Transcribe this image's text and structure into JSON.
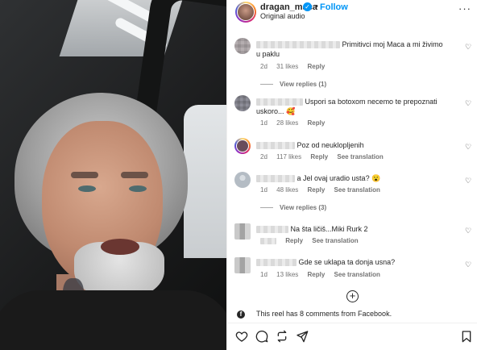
{
  "header": {
    "username": "dragan_maca",
    "verified_glyph": "✓",
    "separator": "•",
    "follow_label": "Follow",
    "audio_label": "Original audio",
    "more_label": "···"
  },
  "comments": [
    {
      "text": "Primitivci moj Maca a mi živimo u paklu",
      "time": "2d",
      "likes": "31 likes",
      "reply": "Reply",
      "translation": "",
      "view_replies": "View replies (1)"
    },
    {
      "text": "Uspori sa botoxom necemo te prepoznati uskoro... 🥰",
      "time": "1d",
      "likes": "28 likes",
      "reply": "Reply",
      "translation": "",
      "view_replies": ""
    },
    {
      "text": "Poz od neuklopljenih",
      "time": "2d",
      "likes": "117 likes",
      "reply": "Reply",
      "translation": "See translation",
      "view_replies": ""
    },
    {
      "text": "a Jel ovaj uradio usta? 😮",
      "time": "1d",
      "likes": "48 likes",
      "reply": "Reply",
      "translation": "See translation",
      "view_replies": "View replies (3)"
    },
    {
      "text": "Na šta ličiš...Miki Rurk 2",
      "time": "",
      "likes": "",
      "reply": "Reply",
      "translation": "See translation",
      "view_replies": ""
    },
    {
      "text": "Gde se uklapa ta donja usna?",
      "time": "1d",
      "likes": "13 likes",
      "reply": "Reply",
      "translation": "See translation",
      "view_replies": ""
    }
  ],
  "load_more_glyph": "+",
  "facebook_note": "This reel has 8 comments from Facebook.",
  "facebook_glyph": "f",
  "icons": [
    "heart-icon",
    "comment-icon",
    "repost-icon",
    "share-icon",
    "bookmark-icon"
  ],
  "colors": {
    "accent": "#0095f6",
    "text": "#262626",
    "meta": "#737373"
  }
}
